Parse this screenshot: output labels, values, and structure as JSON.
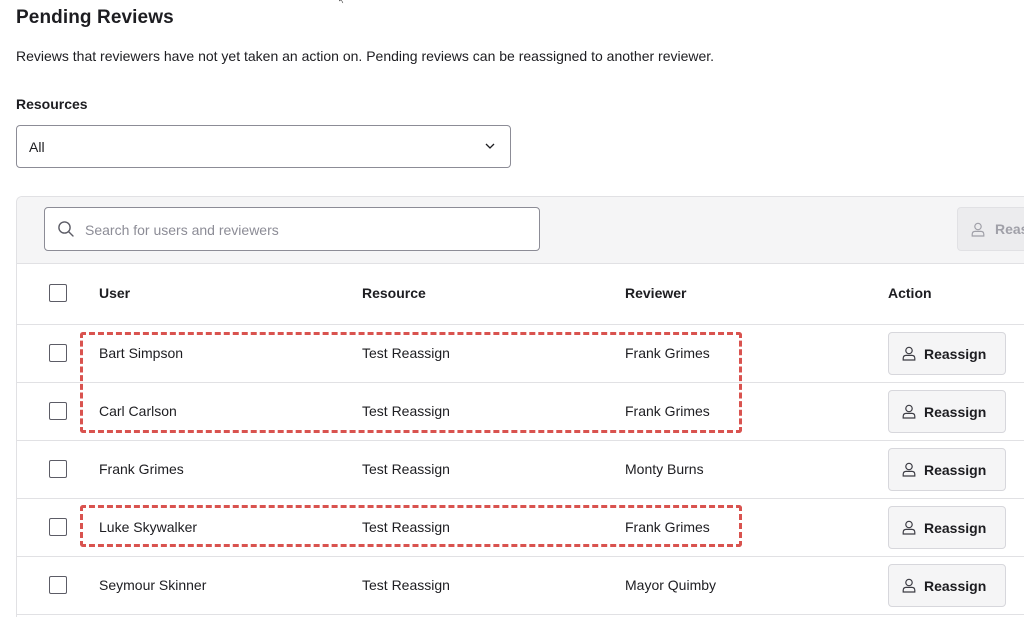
{
  "page": {
    "title": "Pending Reviews",
    "description": "Reviews that reviewers have not yet taken an action on. Pending reviews can be reassigned to another reviewer."
  },
  "filter": {
    "label": "Resources",
    "selected": "All"
  },
  "toolbar": {
    "search_placeholder": "Search for users and reviewers",
    "search_value": "",
    "bulk_button_label": "Reassign"
  },
  "table": {
    "columns": [
      "User",
      "Resource",
      "Reviewer",
      "Action"
    ],
    "action_label": "Reassign",
    "rows": [
      {
        "user": "Bart Simpson",
        "resource": "Test Reassign",
        "reviewer": "Frank Grimes",
        "action": "Reassign",
        "checked": false
      },
      {
        "user": "Carl Carlson",
        "resource": "Test Reassign",
        "reviewer": "Frank Grimes",
        "action": "Reassign",
        "checked": false
      },
      {
        "user": "Frank Grimes",
        "resource": "Test Reassign",
        "reviewer": "Monty Burns",
        "action": "Reassign",
        "checked": false
      },
      {
        "user": "Luke Skywalker",
        "resource": "Test Reassign",
        "reviewer": "Frank Grimes",
        "action": "Reassign",
        "checked": false
      },
      {
        "user": "Seymour Skinner",
        "resource": "Test Reassign",
        "reviewer": "Mayor Quimby",
        "action": "Reassign",
        "checked": false
      }
    ]
  },
  "colors": {
    "highlight": "#d9534f",
    "toolbar_bg": "#f5f5f6",
    "border": "#e1e1e4",
    "text": "#1d1d21"
  },
  "icons": {
    "search": "search-icon",
    "person": "person-icon",
    "chevron": "chevron-down-icon"
  }
}
